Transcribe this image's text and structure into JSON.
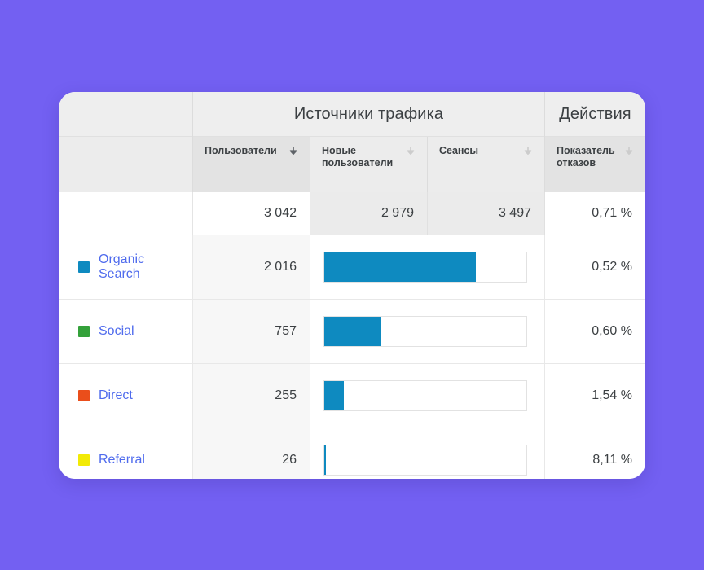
{
  "theme": {
    "page_background": "#7360f2",
    "card_background": "#ffffff",
    "bar_color": "#0e8ac0",
    "link_color": "#4f6bed",
    "header_background": "#eeeeee"
  },
  "card": {
    "group_headers": {
      "blank": "",
      "traffic_sources": "Источники трафика",
      "actions": "Действия"
    },
    "columns": [
      {
        "label": "",
        "sort_icon": "",
        "sort_active": false
      },
      {
        "label": "Пользователи",
        "sort_icon": "arrow-down-icon",
        "sort_active": true
      },
      {
        "label": "Новые пользователи",
        "sort_icon": "arrow-down-icon",
        "sort_active": false
      },
      {
        "label": "Сеансы",
        "sort_icon": "arrow-down-icon",
        "sort_active": false
      },
      {
        "label": "Показатель отказов",
        "sort_icon": "arrow-down-icon",
        "sort_active": false
      }
    ],
    "totals": {
      "label": "",
      "users": "3 042",
      "new_users": "2 979",
      "sessions": "3 497",
      "bounce_rate": "0,71 %"
    },
    "rows": [
      {
        "name": "Organic Search",
        "swatch_color": "#0e8ac0",
        "users": "2 016",
        "bar_percent": 75,
        "bounce_rate": "0,52 %"
      },
      {
        "name": "Social",
        "swatch_color": "#34a13a",
        "users": "757",
        "bar_percent": 28,
        "bounce_rate": "0,60 %"
      },
      {
        "name": "Direct",
        "swatch_color": "#ea4e1b",
        "users": "255",
        "bar_percent": 9.5,
        "bounce_rate": "1,54 %"
      },
      {
        "name": "Referral",
        "swatch_color": "#f2ea06",
        "users": "26",
        "bar_percent": 1,
        "bounce_rate": "8,11 %"
      }
    ]
  },
  "chart_data": {
    "type": "bar",
    "title": "Источники трафика",
    "categories": [
      "Organic Search",
      "Social",
      "Direct",
      "Referral"
    ],
    "series": [
      {
        "name": "Пользователи",
        "values": [
          2016,
          757,
          255,
          26
        ]
      }
    ],
    "bar_values_pct_of_max": [
      75,
      28,
      9.5,
      1
    ],
    "secondary_metrics": [
      {
        "name": "Показатель отказов",
        "values": [
          0.52,
          0.6,
          1.54,
          8.11
        ],
        "unit": "%"
      }
    ],
    "totals": {
      "users": 3042,
      "new_users": 2979,
      "sessions": 3497,
      "bounce_rate": 0.71
    },
    "xlabel": "",
    "ylabel": "Пользователи",
    "grid": false,
    "legend": "none",
    "orientation": "horizontal"
  }
}
